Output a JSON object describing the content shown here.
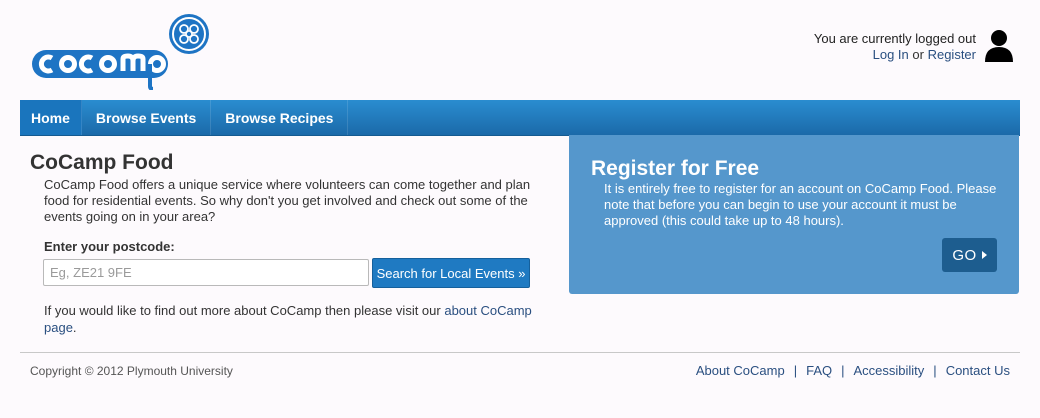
{
  "header": {
    "logo_text": "CoCamp",
    "login_status": "You are currently logged out",
    "login_link": "Log In",
    "or_text": "or",
    "register_link": "Register"
  },
  "nav": {
    "items": [
      {
        "label": "Home"
      },
      {
        "label": "Browse Events"
      },
      {
        "label": "Browse Recipes"
      }
    ]
  },
  "main": {
    "title": "CoCamp Food",
    "intro": "CoCamp Food offers a unique service where volunteers can come together and plan food for residential events. So why don't you get involved and check out some of the events going on in your area?",
    "postcode_label": "Enter your postcode:",
    "postcode_placeholder": "Eg, ZE21 9FE",
    "search_button": "Search for Local Events »",
    "more_info_prefix": "If you would like to find out more about CoCamp then please visit our",
    "more_info_link": "about CoCamp page",
    "more_info_suffix": "."
  },
  "register": {
    "title": "Register for Free",
    "text": "It is entirely free to register for an account on CoCamp Food. Please note that before you can begin to use your account it must be approved (this could take up to 48 hours).",
    "go_button": "GO"
  },
  "footer": {
    "copyright": "Copyright © 2012 Plymouth University",
    "links": [
      "About CoCamp",
      "FAQ",
      "Accessibility",
      "Contact Us"
    ],
    "separator": "|"
  },
  "colors": {
    "nav_blue": "#1b6aa9",
    "register_panel": "#5597cc",
    "go_button": "#1d5d8f",
    "link": "#2a4f80"
  }
}
